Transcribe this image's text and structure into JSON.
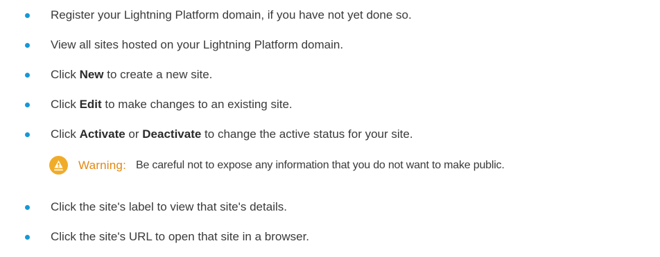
{
  "bullet_color": "#1798d4",
  "warning_color": "#f0ac29",
  "items_top": [
    {
      "text": "Register your Lightning Platform domain, if you have not yet done so."
    },
    {
      "text": "View all sites hosted on your Lightning Platform domain."
    },
    {
      "pre": "Click ",
      "bold": "New",
      "post": " to create a new site."
    },
    {
      "pre": "Click ",
      "bold": "Edit",
      "post": " to make changes to an existing site."
    },
    {
      "pre": "Click ",
      "bold": "Activate",
      "mid": " or ",
      "bold2": "Deactivate",
      "post": " to change the active status for your site."
    }
  ],
  "warning": {
    "icon": "warning-icon",
    "label": "Warning:",
    "text": "Be careful not to expose any information that you do not want to make public."
  },
  "items_bottom": [
    {
      "text": "Click the site's label to view that site's details."
    },
    {
      "text": "Click the site's URL to open that site in a browser."
    }
  ]
}
